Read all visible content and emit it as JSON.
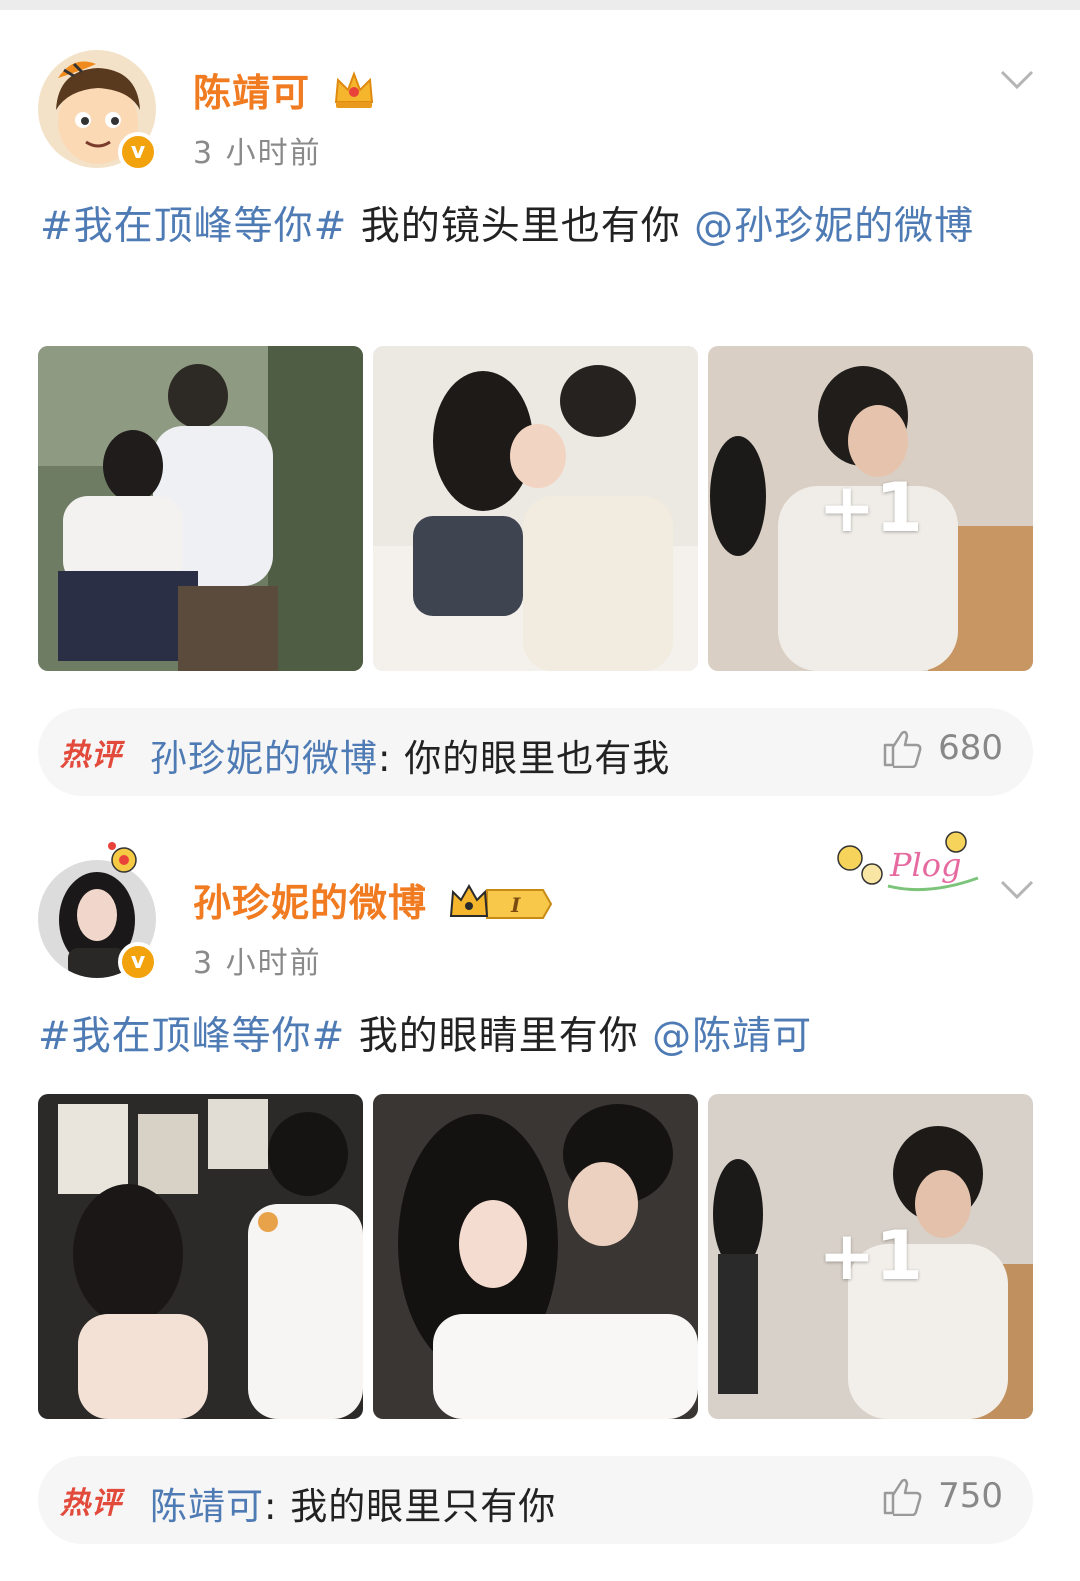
{
  "posts": [
    {
      "username": "陈靖可",
      "time": "3 小时前",
      "hashtag": "#我在顶峰等你#",
      "body": " 我的镜头里也有你 ",
      "mention": "@孙珍妮的微博",
      "more_images": "+1",
      "hot_comment": {
        "badge": "热评",
        "user": "孙珍妮的微博",
        "text": ": 你的眼里也有我",
        "likes": "680"
      }
    },
    {
      "username": "孙珍妮的微博",
      "time": "3 小时前",
      "hashtag": "#我在顶峰等你#",
      "body": " 我的眼睛里有你 ",
      "mention": "@陈靖可",
      "more_images": "+1",
      "level_badge": "I",
      "sticker_text": "Plog",
      "hot_comment": {
        "badge": "热评",
        "user": "陈靖可",
        "text": ": 我的眼里只有你",
        "likes": "750"
      }
    }
  ],
  "colors": {
    "username": "#f07b21",
    "link": "#4f7bb5",
    "hot_badge": "#e24a3b"
  }
}
